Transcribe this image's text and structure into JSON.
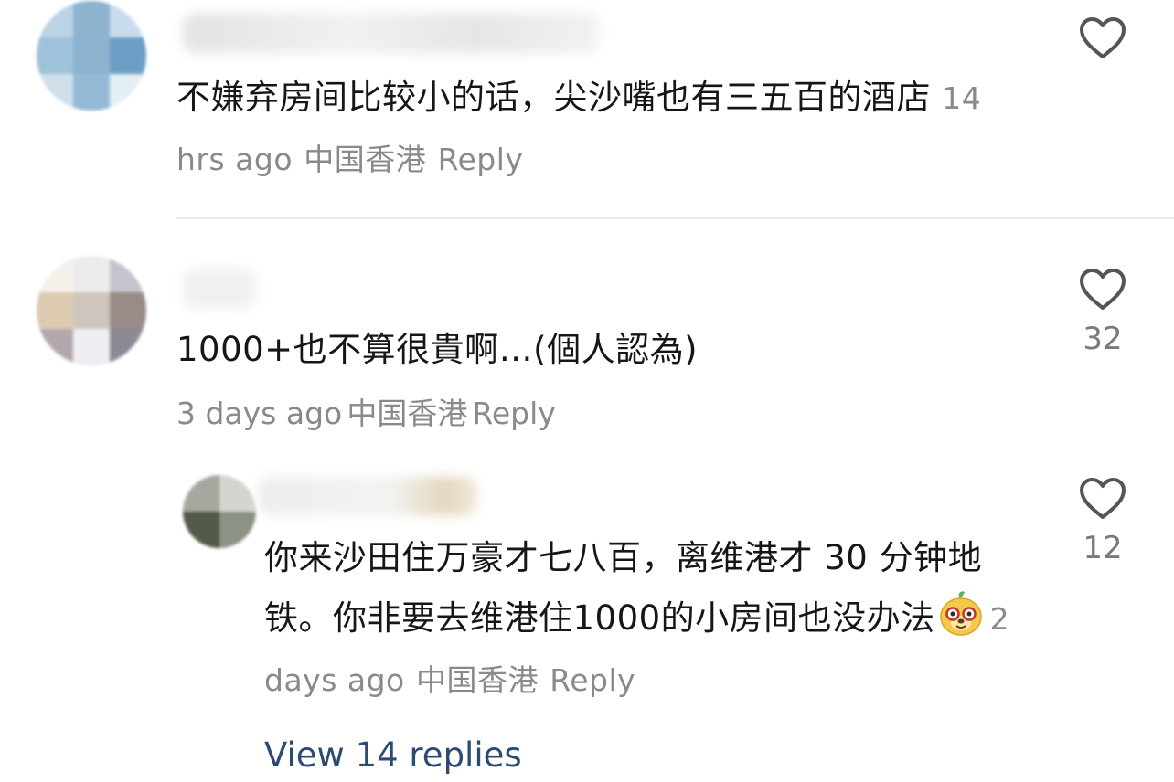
{
  "colors": {
    "text": "#161616",
    "meta": "#8a8a8a",
    "link": "#2b4b75",
    "divider": "#e8e8e8",
    "icon": "#555555"
  },
  "comments": [
    {
      "text": "不嫌弃房间比较小的话，尖沙嘴也有三五百的酒店",
      "time": "14 hrs ago",
      "location": "中国香港",
      "reply_label": "Reply",
      "like_count": ""
    },
    {
      "text": "1000+也不算很貴啊…(個人認為)",
      "time": "3 days ago",
      "location": "中国香港",
      "reply_label": "Reply",
      "like_count": "32"
    },
    {
      "text": "你来沙田住万豪才七八百，离维港才 30 分钟地铁。你非要去维港住1000的小房间也没办法",
      "emoji": "bear-face-emoji",
      "time": "2 days ago",
      "location": "中国香港",
      "reply_label": "Reply",
      "like_count": "12"
    }
  ],
  "view_replies_label": "View 14 replies",
  "icons": {
    "like": "heart-outline-icon"
  }
}
